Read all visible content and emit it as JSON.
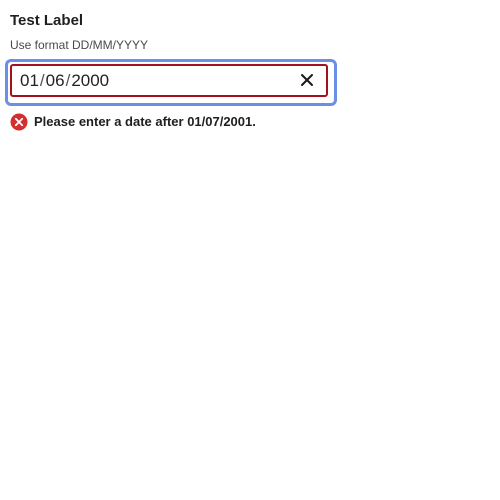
{
  "field": {
    "label": "Test Label",
    "hint": "Use format DD/MM/YYYY",
    "value": {
      "day": "01",
      "month": "06",
      "year": "2000",
      "separator": "/"
    },
    "error_message": "Please enter a date after 01/07/2001."
  },
  "icons": {
    "clear": "close-icon",
    "error": "error-circle-icon"
  },
  "colors": {
    "focus_ring": "#6b8fe6",
    "error_border": "#a3121a",
    "error_icon": "#d32f2f"
  }
}
